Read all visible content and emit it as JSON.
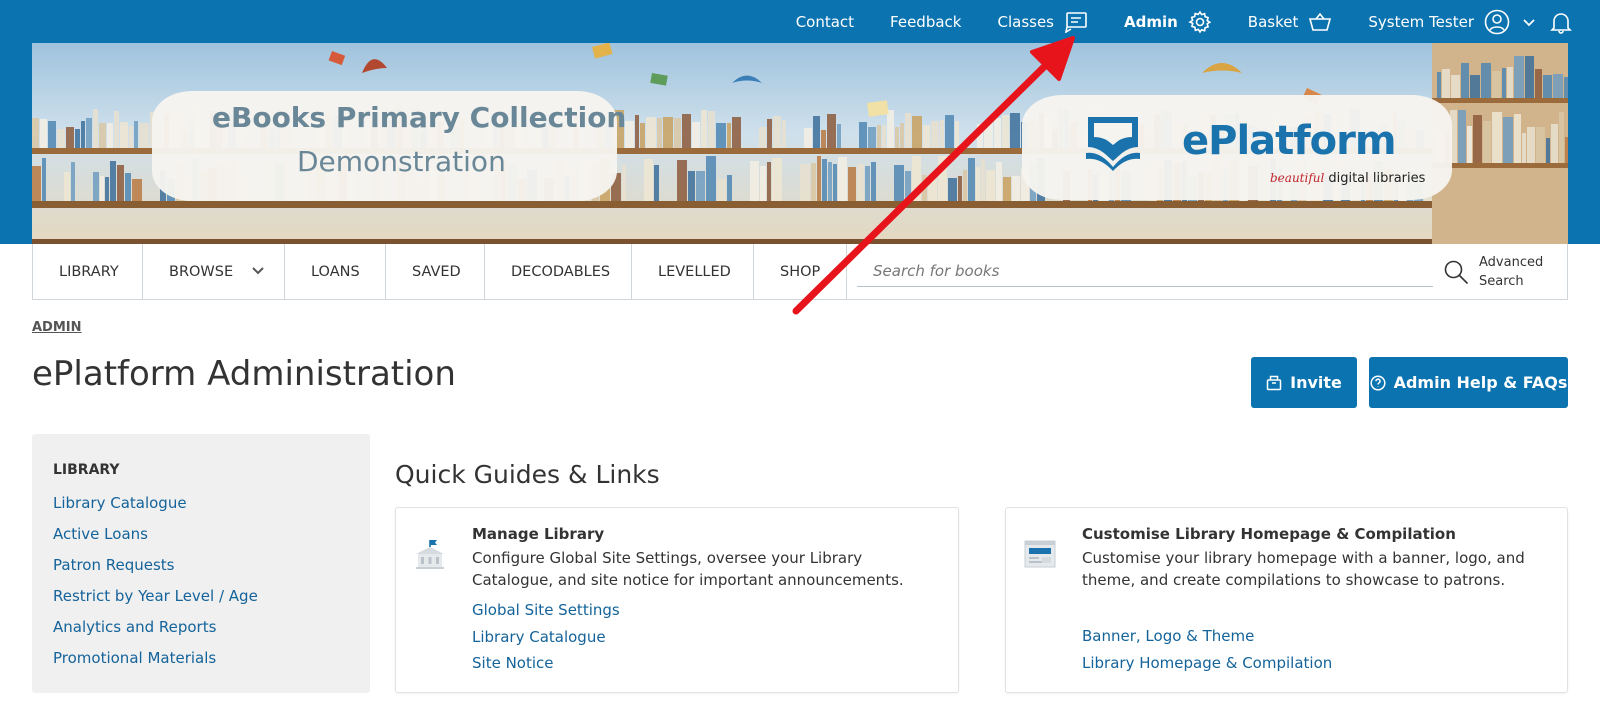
{
  "topnav": {
    "contact": "Contact",
    "feedback": "Feedback",
    "classes": "Classes",
    "admin": "Admin",
    "basket": "Basket",
    "user": "System Tester",
    "icons": [
      "chat-list-icon",
      "gear-icon",
      "basket-icon",
      "user-avatar-icon",
      "chevron-down-icon",
      "bell-icon"
    ]
  },
  "banner": {
    "title": "eBooks Primary Collection",
    "subtitle": "Demonstration",
    "logo_name": "ePlatform",
    "logo_tag_script": "beautiful",
    "logo_tag": "digital libraries"
  },
  "mainnav": {
    "tabs": [
      {
        "label": "LIBRARY"
      },
      {
        "label": "BROWSE"
      },
      {
        "label": "LOANS"
      },
      {
        "label": "SAVED"
      },
      {
        "label": "DECODABLES"
      },
      {
        "label": "LEVELLED"
      },
      {
        "label": "SHOP"
      }
    ],
    "search_placeholder": "Search for books",
    "advanced_search": "Advanced Search"
  },
  "breadcrumb": "ADMIN",
  "page_title": "ePlatform Administration",
  "buttons": {
    "invite": "Invite",
    "help": "Admin Help & FAQs"
  },
  "sidebar": {
    "heading": "LIBRARY",
    "items": [
      "Library Catalogue",
      "Active Loans",
      "Patron Requests",
      "Restrict by Year Level / Age",
      "Analytics and Reports",
      "Promotional Materials"
    ]
  },
  "quick_guides": {
    "title": "Quick Guides & Links",
    "cards": [
      {
        "title": "Manage Library",
        "description": "Configure Global Site Settings, oversee your Library Catalogue, and site notice for important announcements.",
        "links": [
          "Global Site Settings",
          "Library Catalogue",
          "Site Notice"
        ]
      },
      {
        "title": "Customise Library Homepage & Compilation",
        "description": "Customise your library homepage with a banner, logo, and theme, and create compilations to showcase to patrons.",
        "links": [
          "Banner, Logo & Theme",
          "Library Homepage & Compilation"
        ]
      }
    ]
  },
  "colors": {
    "brand_blue": "#0a73b0",
    "link_blue": "#14639a",
    "annotation_red": "#e8141c"
  }
}
